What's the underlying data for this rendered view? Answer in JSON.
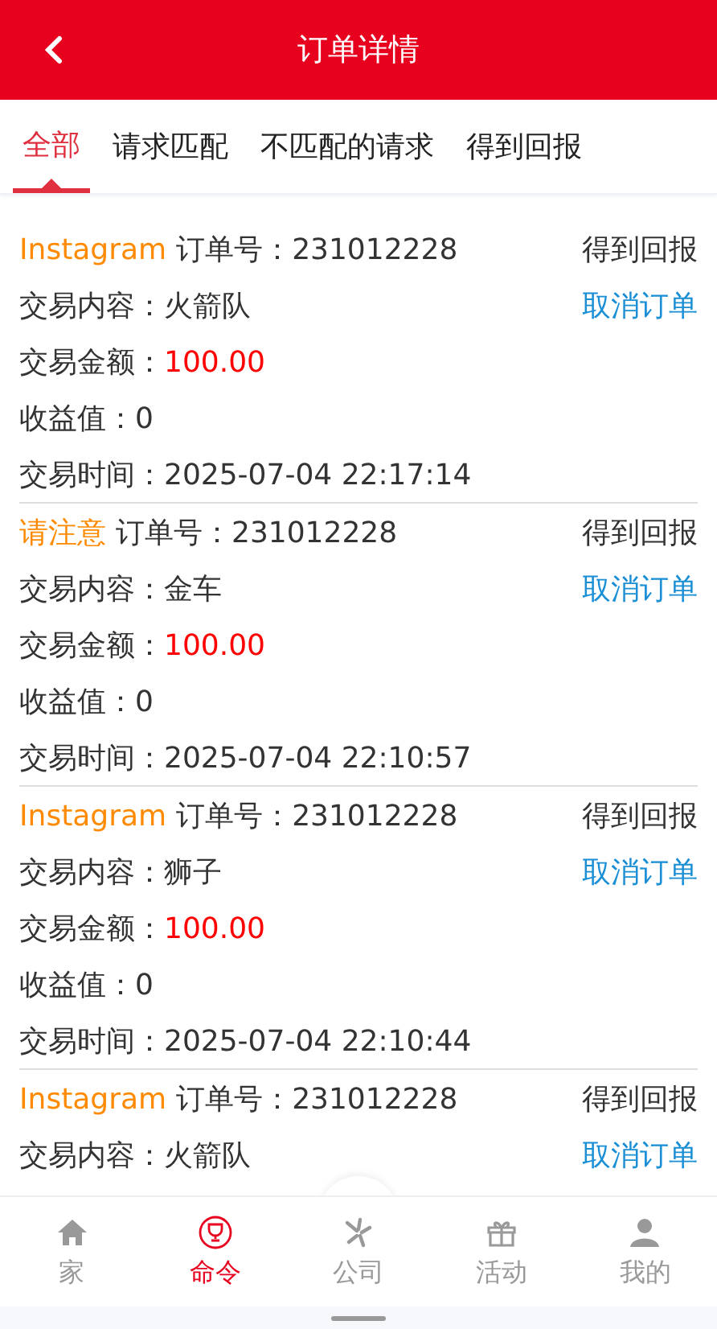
{
  "header": {
    "title": "订单详情"
  },
  "tabs": [
    {
      "label": "全部",
      "selected": true
    },
    {
      "label": "请求匹配",
      "selected": false
    },
    {
      "label": "不匹配的请求",
      "selected": false
    },
    {
      "label": "得到回报",
      "selected": false
    }
  ],
  "orders": [
    {
      "tag": "Instagram",
      "order_no": "订单号：231012228",
      "status": "得到回报",
      "cancel": "取消订单",
      "fields": [
        {
          "kind": "plain",
          "label": "交易内容：",
          "value": "火箭队"
        },
        {
          "kind": "amount",
          "label": "交易金额：",
          "value": "100.00"
        },
        {
          "kind": "plain",
          "label": "收益值：",
          "value": "0"
        },
        {
          "kind": "plain",
          "label": "交易时间：",
          "value": "2025-07-04 22:17:14"
        }
      ]
    },
    {
      "tag": "请注意",
      "order_no": "订单号：231012228",
      "status": "得到回报",
      "cancel": "取消订单",
      "fields": [
        {
          "kind": "plain",
          "label": "交易内容：",
          "value": "金车"
        },
        {
          "kind": "amount",
          "label": "交易金额：",
          "value": "100.00"
        },
        {
          "kind": "plain",
          "label": "收益值：",
          "value": "0"
        },
        {
          "kind": "plain",
          "label": "交易时间：",
          "value": "2025-07-04 22:10:57"
        }
      ]
    },
    {
      "tag": "Instagram",
      "order_no": "订单号：231012228",
      "status": "得到回报",
      "cancel": "取消订单",
      "fields": [
        {
          "kind": "plain",
          "label": "交易内容：",
          "value": "狮子"
        },
        {
          "kind": "amount",
          "label": "交易金额：",
          "value": "100.00"
        },
        {
          "kind": "plain",
          "label": "收益值：",
          "value": "0"
        },
        {
          "kind": "plain",
          "label": "交易时间：",
          "value": "2025-07-04 22:10:44"
        }
      ]
    },
    {
      "tag": "Instagram",
      "order_no": "订单号：231012228",
      "status": "得到回报",
      "cancel": "取消订单",
      "fields": [
        {
          "kind": "plain",
          "label": "交易内容：",
          "value": "火箭队"
        }
      ]
    }
  ],
  "nav": [
    {
      "label": "家",
      "selected": false
    },
    {
      "label": "命令",
      "selected": true
    },
    {
      "label": "公司",
      "selected": false
    },
    {
      "label": "活动",
      "selected": false
    },
    {
      "label": "我的",
      "selected": false
    }
  ]
}
